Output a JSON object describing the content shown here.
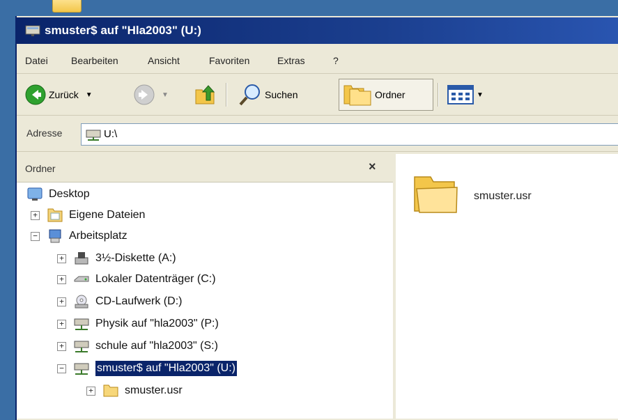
{
  "window": {
    "title": "smuster$ auf \"Hla2003\" (U:)"
  },
  "menu": [
    "Datei",
    "Bearbeiten",
    "Ansicht",
    "Favoriten",
    "Extras",
    "?"
  ],
  "toolbar": {
    "back_label": "Zurück",
    "search_label": "Suchen",
    "folders_label": "Ordner"
  },
  "address": {
    "label": "Adresse",
    "value": "U:\\"
  },
  "folders_pane": {
    "title": "Ordner",
    "close_glyph": "×",
    "tree": [
      {
        "label": "Desktop",
        "icon": "desktop-icon"
      },
      {
        "label": "Eigene Dateien",
        "icon": "my-documents-icon",
        "expander": "+"
      },
      {
        "label": "Arbeitsplatz",
        "icon": "my-computer-icon",
        "expander": "−"
      },
      {
        "label": "3½-Diskette (A:)",
        "icon": "floppy-drive-icon",
        "expander": "+"
      },
      {
        "label": "Lokaler Datenträger (C:)",
        "icon": "hard-drive-icon",
        "expander": "+"
      },
      {
        "label": "CD-Laufwerk (D:)",
        "icon": "cd-drive-icon",
        "expander": "+"
      },
      {
        "label": "Physik auf \"hla2003\" (P:)",
        "icon": "network-drive-icon",
        "expander": "+"
      },
      {
        "label": "schule auf \"hla2003\" (S:)",
        "icon": "network-drive-icon",
        "expander": "+"
      },
      {
        "label": "smuster$ auf \"Hla2003\" (U:)",
        "icon": "network-drive-icon",
        "expander": "−",
        "selected": true
      },
      {
        "label": "smuster.usr",
        "icon": "folder-icon",
        "expander": "+"
      }
    ]
  },
  "content": {
    "items": [
      {
        "label": "smuster.usr",
        "icon": "folder-icon"
      }
    ]
  },
  "colors": {
    "titlebar": "#0a246a",
    "selection": "#0a246a",
    "desktop": "#3a6ea5"
  }
}
